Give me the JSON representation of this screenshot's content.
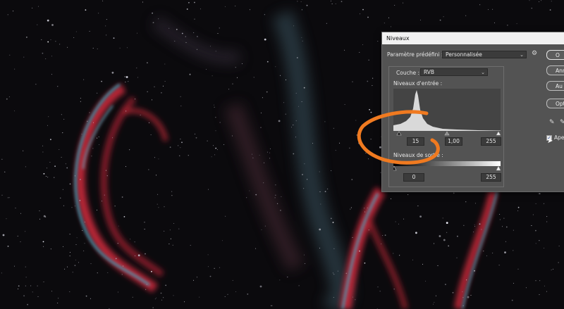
{
  "dialog": {
    "title": "Niveaux",
    "preset_label": "Paramètre prédéfini :",
    "preset_value": "Personnalisée",
    "channel_label": "Couche :",
    "channel_value": "RVB",
    "input_levels_label": "Niveaux d'entrée :",
    "input_black": "15",
    "input_gamma": "1,00",
    "input_white": "255",
    "output_levels_label": "Niveaux de sortie :",
    "output_black": "0",
    "output_white": "255",
    "buttons": {
      "ok": "O",
      "cancel": "Ann",
      "auto": "Au",
      "options": "Optio"
    },
    "preview_label": "Aper",
    "preview_checked": true
  },
  "annotation": {
    "circle_color": "#f07a20"
  },
  "colors": {
    "nebula_red": "#c8283a",
    "nebula_cyan": "#2fb6d0",
    "sky": "#0b0a0d"
  }
}
